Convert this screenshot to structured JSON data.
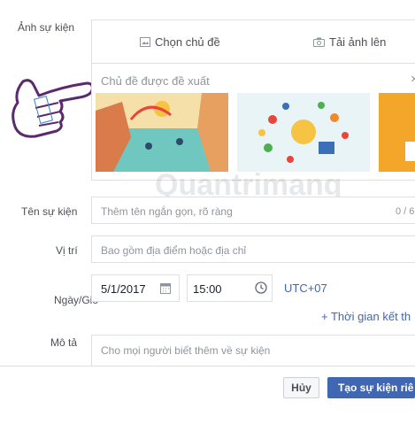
{
  "form": {
    "photo_label": "Ảnh sự kiện",
    "choose_theme": "Chọn chủ đề",
    "upload_photo": "Tải ảnh lên",
    "suggested_themes": "Chủ đề được đề xuất",
    "close_symbol": "×",
    "name_label": "Tên sự kiện",
    "name_placeholder": "Thêm tên ngắn gọn, rõ ràng",
    "name_counter": "0 / 6",
    "location_label": "Vị trí",
    "location_placeholder": "Bao gồm địa điểm hoặc địa chỉ",
    "datetime_label": "Ngày/Giờ",
    "date_value": "5/1/2017",
    "time_value": "15:00",
    "timezone": "UTC+07",
    "add_end_time": "+ Thời gian kết th",
    "description_label": "Mô tả",
    "description_placeholder": "Cho mọi người biết thêm về sự kiện"
  },
  "footer": {
    "cancel": "Hủy",
    "create": "Tạo sự kiện riê"
  },
  "watermark": "Quantrimang",
  "colors": {
    "accent": "#4267b2",
    "link": "#365899",
    "border": "#dddfe2",
    "hand": "#5b2a6e"
  },
  "icons": [
    "image-icon",
    "camera-icon",
    "calendar-icon",
    "clock-icon",
    "pointing-hand-icon"
  ]
}
